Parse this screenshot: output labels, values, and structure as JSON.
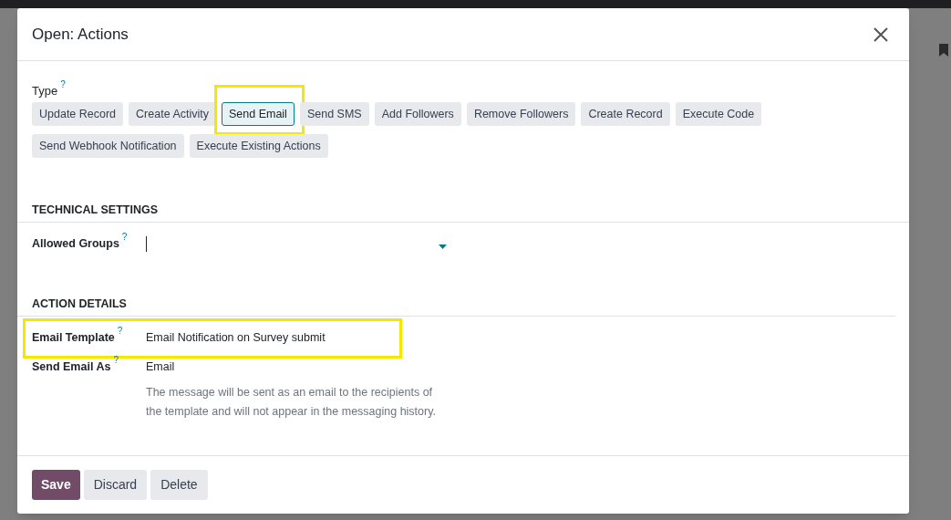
{
  "dialog": {
    "title": "Open: Actions"
  },
  "type_field": {
    "label": "Type",
    "help": "?",
    "options": [
      {
        "label": "Update Record",
        "selected": false,
        "highlighted": false
      },
      {
        "label": "Create Activity",
        "selected": false,
        "highlighted": false
      },
      {
        "label": "Send Email",
        "selected": true,
        "highlighted": true
      },
      {
        "label": "Send SMS",
        "selected": false,
        "highlighted": false
      },
      {
        "label": "Add Followers",
        "selected": false,
        "highlighted": false
      },
      {
        "label": "Remove Followers",
        "selected": false,
        "highlighted": false
      },
      {
        "label": "Create Record",
        "selected": false,
        "highlighted": false
      },
      {
        "label": "Execute Code",
        "selected": false,
        "highlighted": false
      },
      {
        "label": "Send Webhook Notification",
        "selected": false,
        "highlighted": false
      },
      {
        "label": "Execute Existing Actions",
        "selected": false,
        "highlighted": false
      }
    ]
  },
  "sections": [
    {
      "title": "TECHNICAL SETTINGS",
      "fields": [
        {
          "kind": "select",
          "label": "Allowed Groups",
          "help": "?",
          "highlighted": false
        }
      ]
    },
    {
      "title": "ACTION DETAILS",
      "fields": [
        {
          "kind": "text",
          "label": "Email Template",
          "help": "?",
          "value": "Email Notification on Survey submit",
          "highlighted": true
        },
        {
          "kind": "text",
          "label": "Send Email As",
          "help": "?",
          "value": "Email",
          "note": "The message will be sent as an email to the recipients of the template and will not appear in the messaging history.",
          "highlighted": false
        }
      ]
    }
  ],
  "footer_buttons": [
    {
      "label": "Save",
      "kind": "primary"
    },
    {
      "label": "Discard",
      "kind": "secondary"
    },
    {
      "label": "Delete",
      "kind": "secondary"
    }
  ]
}
